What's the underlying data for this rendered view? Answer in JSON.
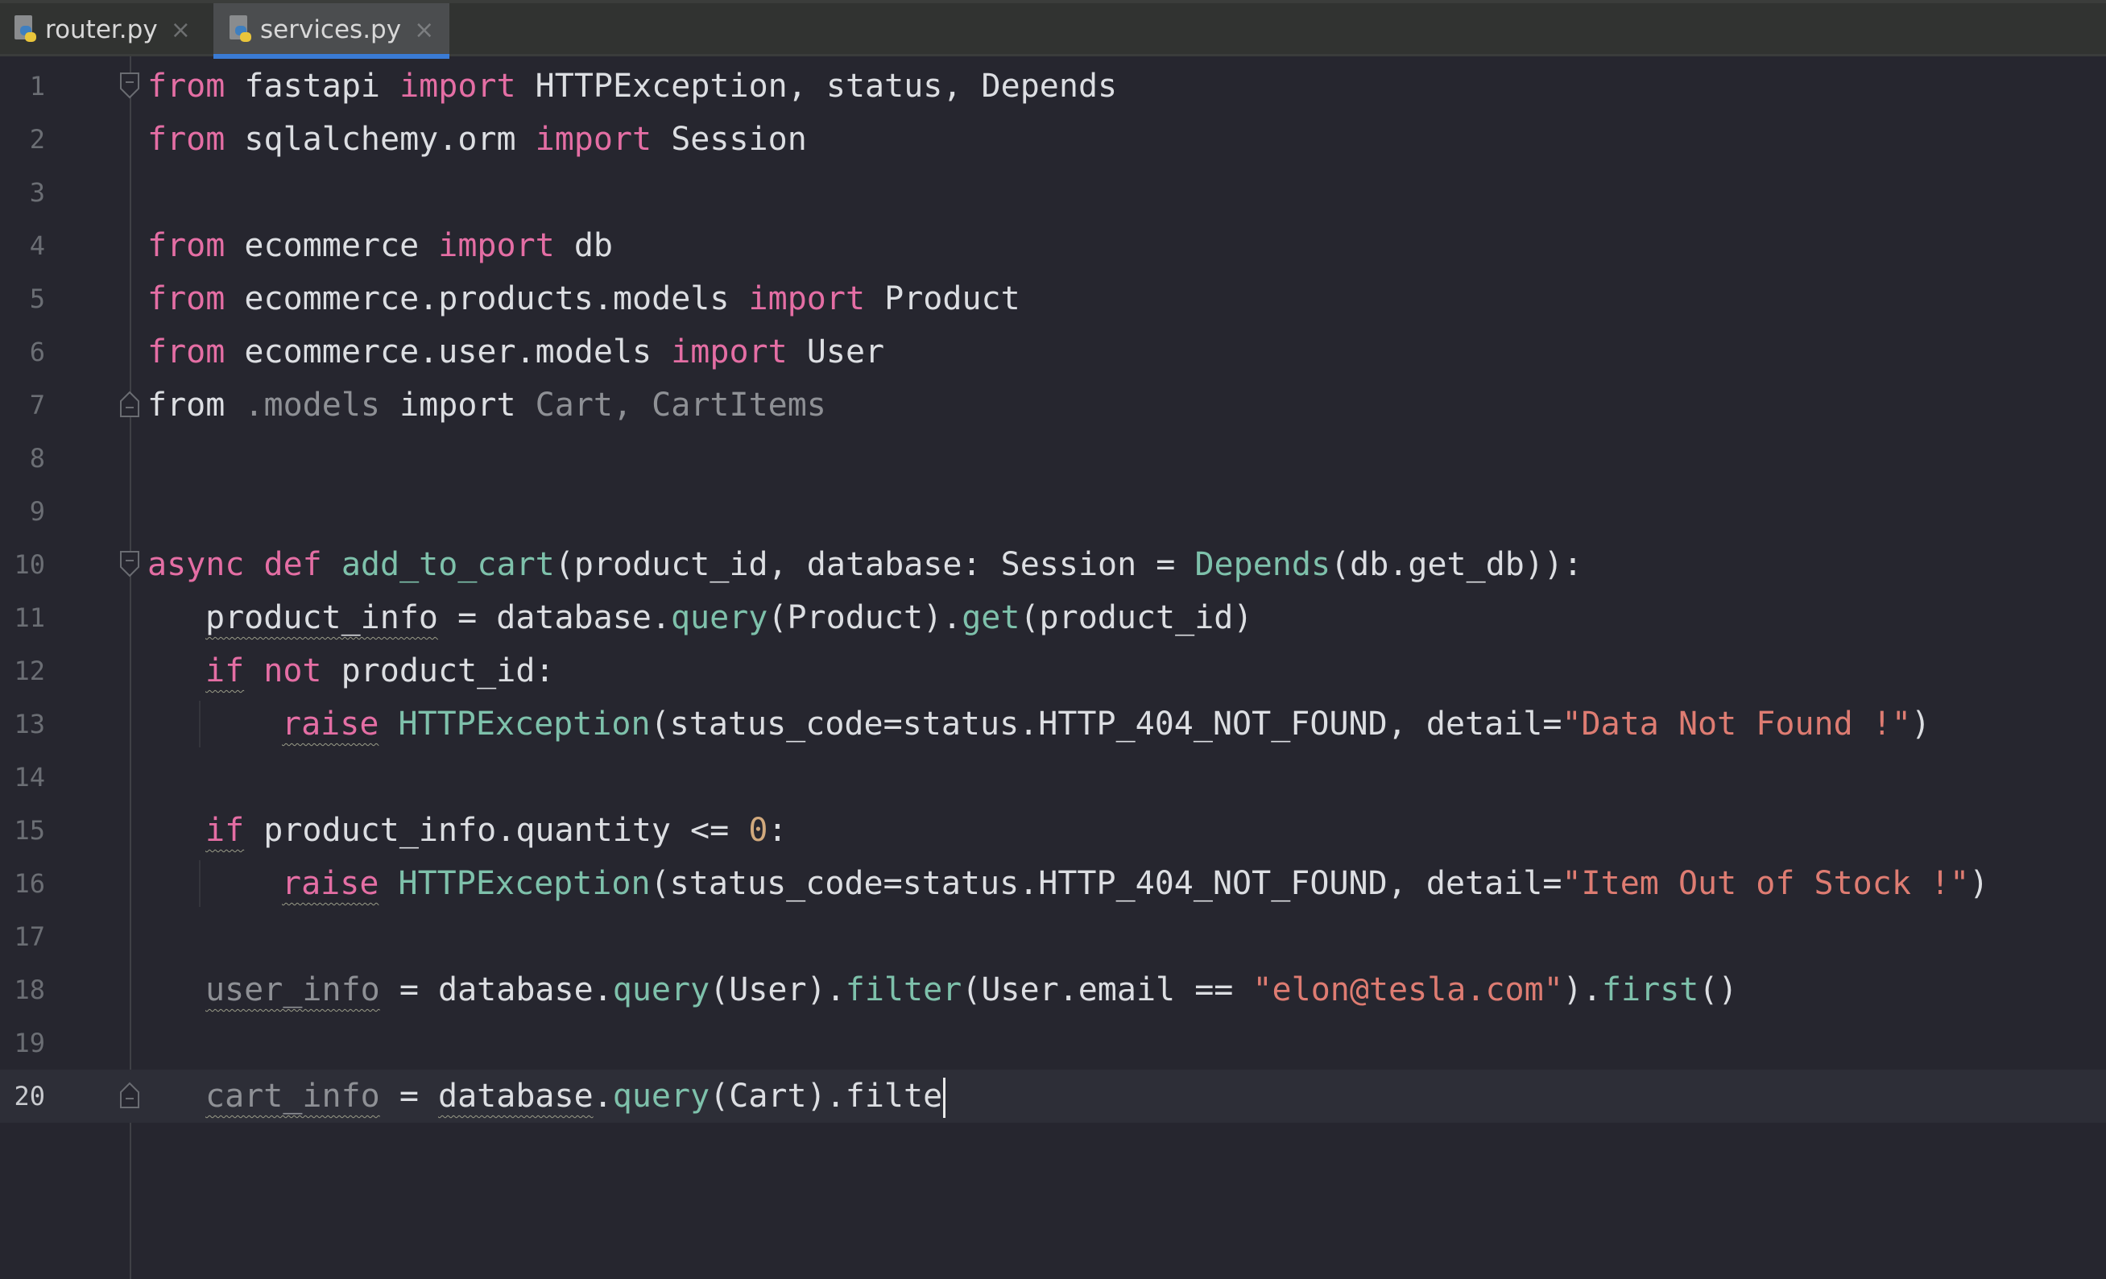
{
  "tabs": [
    {
      "label": "router.py",
      "icon": "python-file-icon",
      "active": false
    },
    {
      "label": "services.py",
      "icon": "python-file-icon",
      "active": true
    }
  ],
  "close_glyph": "×",
  "colors": {
    "accent": "#3a7bd5",
    "keyword": "#e46ea4",
    "function": "#7ec1ab",
    "string": "#de7c72",
    "number": "#d1a97d",
    "text": "#dcdee2",
    "unused": "#8e9095",
    "background": "#26262f"
  },
  "editor": {
    "current_line": 20,
    "lines": [
      {
        "n": "1",
        "tokens": [
          [
            "kw",
            "from"
          ],
          [
            "",
            " fastapi "
          ],
          [
            "kw",
            "import"
          ],
          [
            "",
            " HTTPException, status, Depends"
          ]
        ]
      },
      {
        "n": "2",
        "tokens": [
          [
            "kw",
            "from"
          ],
          [
            "",
            " sqlalchemy.orm "
          ],
          [
            "kw",
            "import"
          ],
          [
            "",
            " Session"
          ]
        ]
      },
      {
        "n": "3",
        "tokens": []
      },
      {
        "n": "4",
        "tokens": [
          [
            "kw",
            "from"
          ],
          [
            "",
            " ecommerce "
          ],
          [
            "kw",
            "import"
          ],
          [
            "",
            " db"
          ]
        ]
      },
      {
        "n": "5",
        "tokens": [
          [
            "kw",
            "from"
          ],
          [
            "",
            " ecommerce.products.models "
          ],
          [
            "kw",
            "import"
          ],
          [
            "",
            " Product"
          ]
        ]
      },
      {
        "n": "6",
        "tokens": [
          [
            "kw",
            "from"
          ],
          [
            "",
            " ecommerce.user.models "
          ],
          [
            "kw",
            "import"
          ],
          [
            "",
            " User"
          ]
        ]
      },
      {
        "n": "7",
        "tokens": [
          [
            "",
            "from"
          ],
          [
            "dim",
            " .models "
          ],
          [
            "",
            "import"
          ],
          [
            "dim",
            " Cart, CartItems"
          ]
        ]
      },
      {
        "n": "8",
        "tokens": []
      },
      {
        "n": "9",
        "tokens": []
      },
      {
        "n": "10",
        "tokens": [
          [
            "kw",
            "async def "
          ],
          [
            "fn",
            "add_to_cart"
          ],
          [
            "",
            "(product_id, database: Session = "
          ],
          [
            "fn",
            "Depends"
          ],
          [
            "",
            "(db.get_db)):"
          ]
        ]
      },
      {
        "n": "11",
        "tokens": [
          [
            "sq",
            "product_info"
          ],
          [
            "",
            " = database."
          ],
          [
            "fn",
            "query"
          ],
          [
            "",
            "(Product)."
          ],
          [
            "fn",
            "get"
          ],
          [
            "",
            "(product_id)"
          ]
        ]
      },
      {
        "n": "12",
        "tokens": [
          [
            "kw sq",
            "if"
          ],
          [
            "kw",
            " not"
          ],
          [
            "",
            " product_id:"
          ]
        ]
      },
      {
        "n": "13",
        "tokens": [
          [
            "kw sq",
            "raise"
          ],
          [
            "",
            " "
          ],
          [
            "fn",
            "HTTPException"
          ],
          [
            "",
            "(status_code=status.HTTP_404_NOT_FOUND, detail="
          ],
          [
            "str",
            "\"Data Not Found !\""
          ],
          [
            "",
            ")"
          ]
        ]
      },
      {
        "n": "14",
        "tokens": []
      },
      {
        "n": "15",
        "tokens": [
          [
            "kw sq",
            "if"
          ],
          [
            "",
            " product_info.quantity <= "
          ],
          [
            "num",
            "0"
          ],
          [
            "",
            ":"
          ]
        ]
      },
      {
        "n": "16",
        "tokens": [
          [
            "kw sq",
            "raise"
          ],
          [
            "",
            " "
          ],
          [
            "fn",
            "HTTPException"
          ],
          [
            "",
            "(status_code=status.HTTP_404_NOT_FOUND, detail="
          ],
          [
            "str",
            "\"Item Out of Stock !\""
          ],
          [
            "",
            ")"
          ]
        ]
      },
      {
        "n": "17",
        "tokens": []
      },
      {
        "n": "18",
        "tokens": [
          [
            "dim sq",
            "user_info"
          ],
          [
            "",
            " = database."
          ],
          [
            "fn",
            "query"
          ],
          [
            "",
            "(User)."
          ],
          [
            "fn",
            "filter"
          ],
          [
            "",
            "(User.email == "
          ],
          [
            "str",
            "\"elon@tesla.com\""
          ],
          [
            "",
            ")."
          ],
          [
            "fn",
            "first"
          ],
          [
            "",
            "()"
          ]
        ]
      },
      {
        "n": "19",
        "tokens": []
      },
      {
        "n": "20",
        "tokens": [
          [
            "dim sq",
            "cart_info"
          ],
          [
            "",
            " = "
          ],
          [
            "sq",
            "database"
          ],
          [
            "",
            "."
          ],
          [
            "fn",
            "query"
          ],
          [
            "",
            "(Cart).filte"
          ]
        ]
      }
    ]
  }
}
